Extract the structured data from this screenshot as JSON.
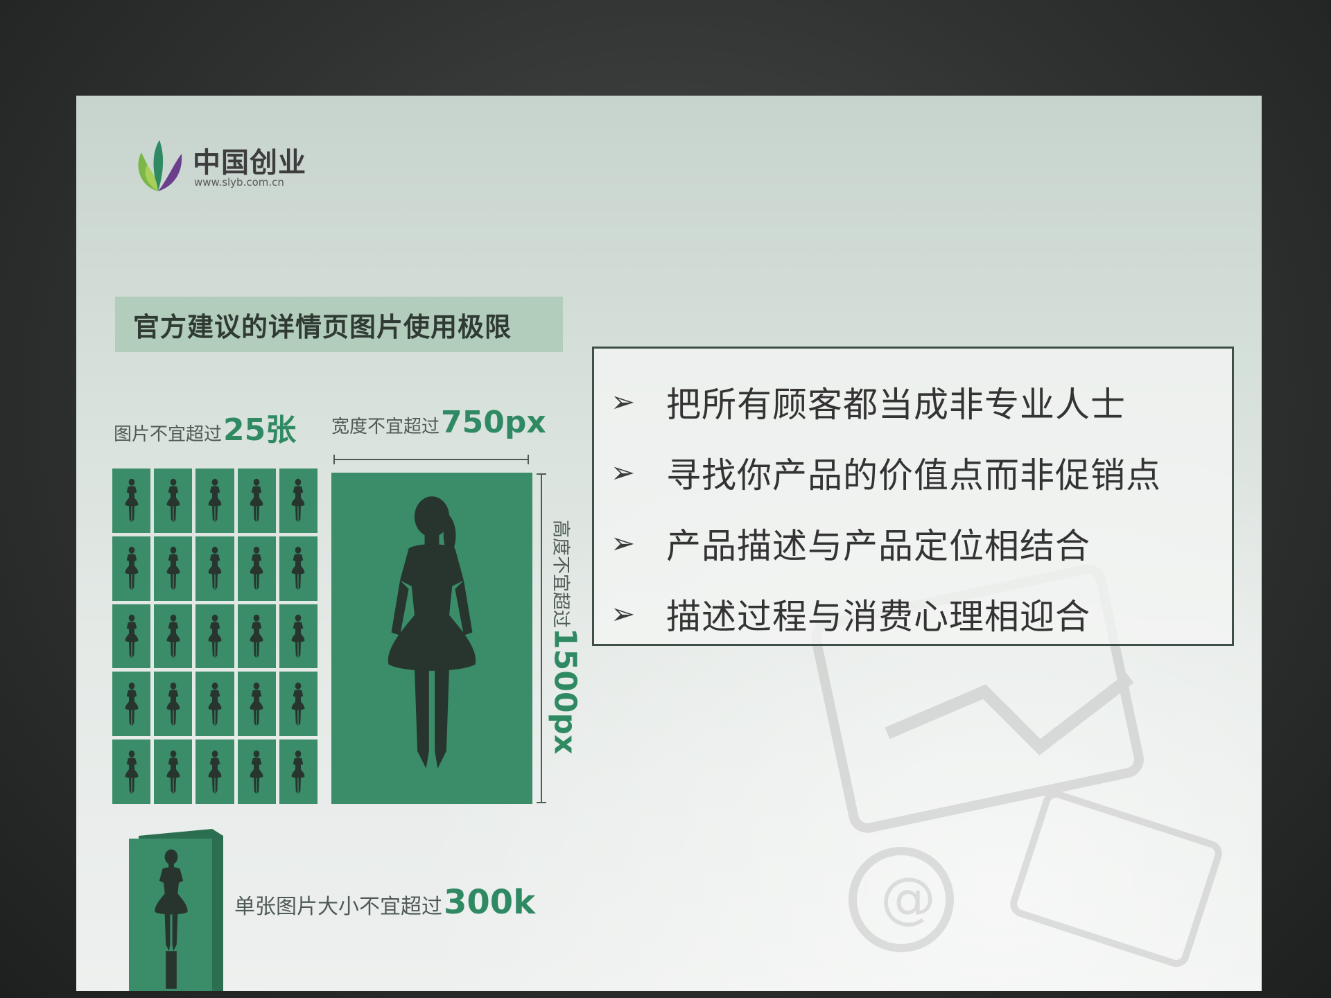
{
  "logo": {
    "name": "中国创业",
    "url": "www.slyb.com.cn"
  },
  "title": "官方建议的详情页图片使用极限",
  "image_count": {
    "prefix": "图片不宜超过",
    "value": "25张"
  },
  "width_limit": {
    "prefix": "宽度不宜超过",
    "value": "750px"
  },
  "height_limit": {
    "prefix": "高度不宜超过",
    "value": "1500px"
  },
  "file_size": {
    "prefix": "单张图片大小不宜超过",
    "value": "300k"
  },
  "bullets": [
    {
      "text": "把所有顾客都当成非专业人士"
    },
    {
      "text": "寻找你产品的价值点而非促销点"
    },
    {
      "text": "产品描述与产品定位相结合"
    },
    {
      "text": "描述过程与消费心理相迎合"
    }
  ],
  "bullet_marker": "➢",
  "colors": {
    "accent_green": "#2f8a63",
    "panel_green": "#3b8c68",
    "silhouette": "#27352e",
    "banner": "#b3cdbd",
    "box_border": "#3f4f48"
  }
}
